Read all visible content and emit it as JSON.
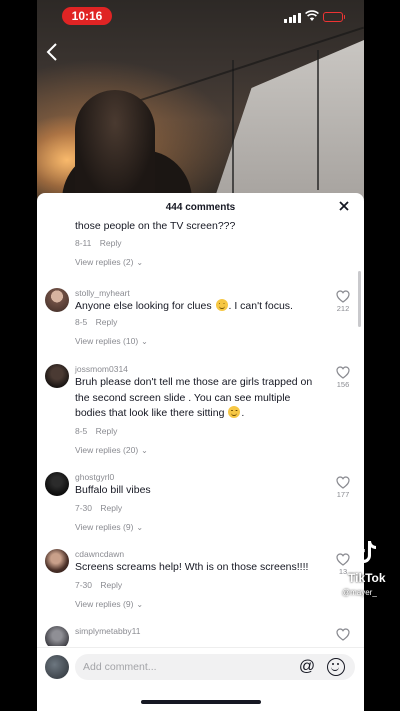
{
  "status_bar": {
    "time": "10:16"
  },
  "sheet": {
    "title": "444 comments",
    "close_icon": "close-icon"
  },
  "comments": [
    {
      "username": "",
      "text": "those people on the TV screen???",
      "date": "8-11",
      "reply": "Reply",
      "view_replies": "View replies (2)",
      "likes": ""
    },
    {
      "username": "stolly_myheart",
      "text_before": "Anyone else looking for clues ",
      "text_after": ". I can't focus.",
      "date": "8-5",
      "reply": "Reply",
      "view_replies": "View replies (10)",
      "likes": "212"
    },
    {
      "username": "jossmom0314",
      "text_before": "Bruh please don't tell me those are girls trapped on the second screen slide . You can see multiple bodies that look like there sitting ",
      "text_after": ".",
      "date": "8-5",
      "reply": "Reply",
      "view_replies": "View replies (20)",
      "likes": "156"
    },
    {
      "username": "ghostgyrl0",
      "text": "Buffalo bill vibes",
      "date": "7-30",
      "reply": "Reply",
      "view_replies": "View replies (9)",
      "likes": "177"
    },
    {
      "username": "cdawncdawn",
      "text": "Screens screams help! Wth is on those screens!!!!",
      "date": "7-30",
      "reply": "Reply",
      "view_replies": "View replies (9)",
      "likes": "13"
    },
    {
      "username": "simplymetabby11",
      "text": "",
      "likes": ""
    }
  ],
  "input": {
    "placeholder": "Add comment..."
  },
  "watermark": {
    "brand": "TikTok",
    "handle": "@mayer_"
  },
  "colors": {
    "accent_red": "#e02424",
    "text_primary": "#161823",
    "text_secondary": "#8a8b91"
  }
}
